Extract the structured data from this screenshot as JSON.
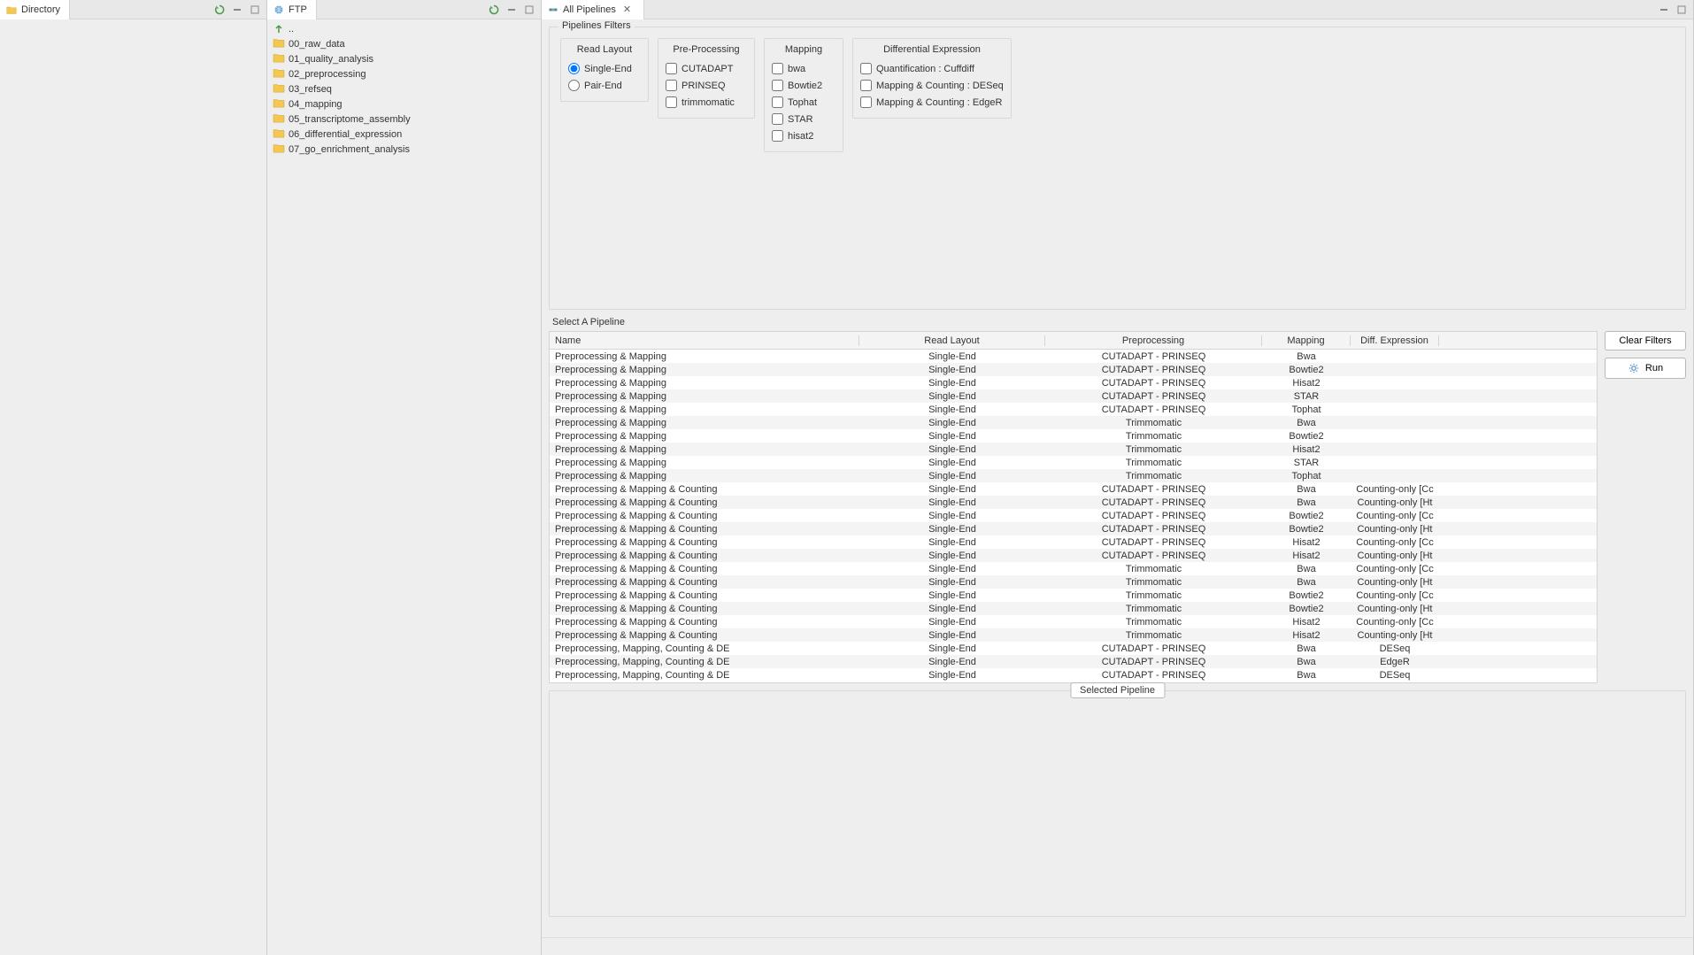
{
  "panels": {
    "directory": {
      "title": "Directory"
    },
    "ftp": {
      "title": "FTP",
      "up_label": "..",
      "folders": [
        "00_raw_data",
        "01_quality_analysis",
        "02_preprocessing",
        "03_refseq",
        "04_mapping",
        "05_transcriptome_assembly",
        "06_differential_expression",
        "07_go_enrichment_analysis"
      ]
    },
    "pipelines": {
      "title": "All Pipelines"
    }
  },
  "filters": {
    "title": "Pipelines Filters",
    "read_layout": {
      "title": "Read Layout",
      "options": [
        "Single-End",
        "Pair-End"
      ],
      "selected": "Single-End"
    },
    "preprocessing": {
      "title": "Pre-Processing",
      "options": [
        "CUTADAPT",
        "PRINSEQ",
        "trimmomatic"
      ]
    },
    "mapping": {
      "title": "Mapping",
      "options": [
        "bwa",
        "Bowtie2",
        "Tophat",
        "STAR",
        "hisat2"
      ]
    },
    "de": {
      "title": "Differential Expression",
      "options": [
        "Quantification : Cuffdiff",
        "Mapping & Counting : DESeq",
        "Mapping & Counting : EdgeR"
      ]
    }
  },
  "table": {
    "select_title": "Select A Pipeline",
    "columns": {
      "name": "Name",
      "rl": "Read Layout",
      "pp": "Preprocessing",
      "map": "Mapping",
      "de": "Diff. Expression"
    },
    "rows": [
      {
        "name": "Preprocessing & Mapping",
        "rl": "Single-End",
        "pp": "CUTADAPT - PRINSEQ",
        "map": "Bwa",
        "de": ""
      },
      {
        "name": "Preprocessing & Mapping",
        "rl": "Single-End",
        "pp": "CUTADAPT - PRINSEQ",
        "map": "Bowtie2",
        "de": ""
      },
      {
        "name": "Preprocessing & Mapping",
        "rl": "Single-End",
        "pp": "CUTADAPT - PRINSEQ",
        "map": "Hisat2",
        "de": ""
      },
      {
        "name": "Preprocessing & Mapping",
        "rl": "Single-End",
        "pp": "CUTADAPT - PRINSEQ",
        "map": "STAR",
        "de": ""
      },
      {
        "name": "Preprocessing & Mapping",
        "rl": "Single-End",
        "pp": "CUTADAPT - PRINSEQ",
        "map": "Tophat",
        "de": ""
      },
      {
        "name": "Preprocessing & Mapping",
        "rl": "Single-End",
        "pp": "Trimmomatic",
        "map": "Bwa",
        "de": ""
      },
      {
        "name": "Preprocessing & Mapping",
        "rl": "Single-End",
        "pp": "Trimmomatic",
        "map": "Bowtie2",
        "de": ""
      },
      {
        "name": "Preprocessing & Mapping",
        "rl": "Single-End",
        "pp": "Trimmomatic",
        "map": "Hisat2",
        "de": ""
      },
      {
        "name": "Preprocessing & Mapping",
        "rl": "Single-End",
        "pp": "Trimmomatic",
        "map": "STAR",
        "de": ""
      },
      {
        "name": "Preprocessing & Mapping",
        "rl": "Single-End",
        "pp": "Trimmomatic",
        "map": "Tophat",
        "de": ""
      },
      {
        "name": "Preprocessing & Mapping & Counting",
        "rl": "Single-End",
        "pp": "CUTADAPT - PRINSEQ",
        "map": "Bwa",
        "de": "Counting-only [Cc"
      },
      {
        "name": "Preprocessing & Mapping & Counting",
        "rl": "Single-End",
        "pp": "CUTADAPT - PRINSEQ",
        "map": "Bwa",
        "de": "Counting-only [Ht"
      },
      {
        "name": "Preprocessing & Mapping & Counting",
        "rl": "Single-End",
        "pp": "CUTADAPT - PRINSEQ",
        "map": "Bowtie2",
        "de": "Counting-only [Cc"
      },
      {
        "name": "Preprocessing & Mapping & Counting",
        "rl": "Single-End",
        "pp": "CUTADAPT - PRINSEQ",
        "map": "Bowtie2",
        "de": "Counting-only [Ht"
      },
      {
        "name": "Preprocessing & Mapping & Counting",
        "rl": "Single-End",
        "pp": "CUTADAPT - PRINSEQ",
        "map": "Hisat2",
        "de": "Counting-only [Cc"
      },
      {
        "name": "Preprocessing & Mapping & Counting",
        "rl": "Single-End",
        "pp": "CUTADAPT - PRINSEQ",
        "map": "Hisat2",
        "de": "Counting-only [Ht"
      },
      {
        "name": "Preprocessing & Mapping & Counting",
        "rl": "Single-End",
        "pp": "Trimmomatic",
        "map": "Bwa",
        "de": "Counting-only [Cc"
      },
      {
        "name": "Preprocessing & Mapping & Counting",
        "rl": "Single-End",
        "pp": "Trimmomatic",
        "map": "Bwa",
        "de": "Counting-only [Ht"
      },
      {
        "name": "Preprocessing & Mapping & Counting",
        "rl": "Single-End",
        "pp": "Trimmomatic",
        "map": "Bowtie2",
        "de": "Counting-only [Cc"
      },
      {
        "name": "Preprocessing & Mapping & Counting",
        "rl": "Single-End",
        "pp": "Trimmomatic",
        "map": "Bowtie2",
        "de": "Counting-only [Ht"
      },
      {
        "name": "Preprocessing & Mapping & Counting",
        "rl": "Single-End",
        "pp": "Trimmomatic",
        "map": "Hisat2",
        "de": "Counting-only [Cc"
      },
      {
        "name": "Preprocessing & Mapping & Counting",
        "rl": "Single-End",
        "pp": "Trimmomatic",
        "map": "Hisat2",
        "de": "Counting-only [Ht"
      },
      {
        "name": "Preprocessing, Mapping, Counting & DE",
        "rl": "Single-End",
        "pp": "CUTADAPT - PRINSEQ",
        "map": "Bwa",
        "de": "DESeq"
      },
      {
        "name": "Preprocessing, Mapping, Counting & DE",
        "rl": "Single-End",
        "pp": "CUTADAPT - PRINSEQ",
        "map": "Bwa",
        "de": "EdgeR"
      },
      {
        "name": "Preprocessing, Mapping, Counting & DE",
        "rl": "Single-End",
        "pp": "CUTADAPT - PRINSEQ",
        "map": "Bwa",
        "de": "DESeq"
      }
    ]
  },
  "buttons": {
    "clear": "Clear Filters",
    "run": "Run",
    "selected": "Selected Pipeline"
  }
}
